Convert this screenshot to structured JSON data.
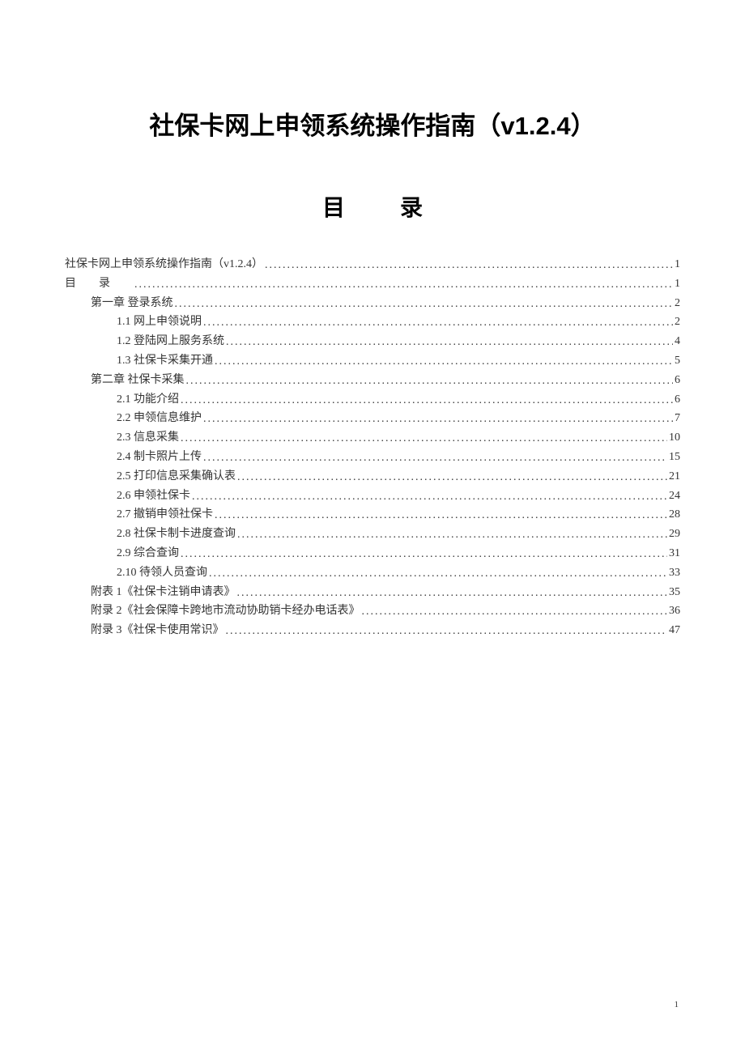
{
  "title": "社保卡网上申领系统操作指南（v1.2.4）",
  "toc_heading": "目　录",
  "toc": [
    {
      "level": 0,
      "label": "社保卡网上申领系统操作指南（v1.2.4）",
      "page": "1",
      "labelClass": ""
    },
    {
      "level": 0,
      "label": "目录",
      "page": "1",
      "labelClass": "mulu-label"
    },
    {
      "level": 1,
      "label": "第一章  登录系统",
      "page": "2",
      "labelClass": ""
    },
    {
      "level": 2,
      "label": "1.1  网上申领说明",
      "page": "2",
      "labelClass": ""
    },
    {
      "level": 2,
      "label": "1.2  登陆网上服务系统",
      "page": "4",
      "labelClass": ""
    },
    {
      "level": 2,
      "label": "1.3  社保卡采集开通",
      "page": "5",
      "labelClass": ""
    },
    {
      "level": 1,
      "label": "第二章  社保卡采集",
      "page": "6",
      "labelClass": ""
    },
    {
      "level": 2,
      "label": "2.1  功能介绍",
      "page": "6",
      "labelClass": ""
    },
    {
      "level": 2,
      "label": "2.2  申领信息维护",
      "page": "7",
      "labelClass": ""
    },
    {
      "level": 2,
      "label": "2.3  信息采集",
      "page": "10",
      "labelClass": ""
    },
    {
      "level": 2,
      "label": "2.4  制卡照片上传",
      "page": "15",
      "labelClass": ""
    },
    {
      "level": 2,
      "label": "2.5  打印信息采集确认表",
      "page": "21",
      "labelClass": ""
    },
    {
      "level": 2,
      "label": "2.6  申领社保卡",
      "page": "24",
      "labelClass": ""
    },
    {
      "level": 2,
      "label": "2.7  撤销申领社保卡",
      "page": "28",
      "labelClass": ""
    },
    {
      "level": 2,
      "label": "2.8  社保卡制卡进度查询",
      "page": "29",
      "labelClass": ""
    },
    {
      "level": 2,
      "label": "2.9  综合查询",
      "page": "31",
      "labelClass": ""
    },
    {
      "level": 2,
      "label": "2.10  待领人员查询",
      "page": "33",
      "labelClass": ""
    },
    {
      "level": 1,
      "label": "附表 1《社保卡注销申请表》",
      "page": "35",
      "labelClass": ""
    },
    {
      "level": 1,
      "label": "附录 2《社会保障卡跨地市流动协助销卡经办电话表》",
      "page": "36",
      "labelClass": ""
    },
    {
      "level": 1,
      "label": "附录 3《社保卡使用常识》",
      "page": "47",
      "labelClass": ""
    }
  ],
  "page_number": "1"
}
